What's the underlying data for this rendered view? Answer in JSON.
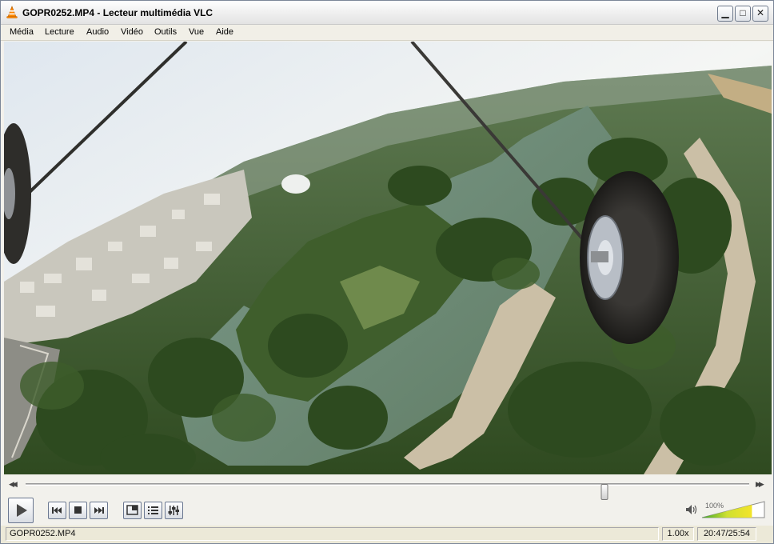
{
  "window": {
    "title": "GOPR0252.MP4 - Lecteur multimédia VLC",
    "app_icon": "vlc-cone-icon",
    "controls": [
      "minimize-icon",
      "maximize-icon",
      "close-icon"
    ]
  },
  "menu": {
    "items": [
      "Média",
      "Lecture",
      "Audio",
      "Vidéo",
      "Outils",
      "Vue",
      "Aide"
    ]
  },
  "video": {
    "description_icon": "video-frame"
  },
  "seek": {
    "position_fraction": 0.8,
    "back_icon": "seek-back-icon",
    "forward_icon": "seek-forward-icon"
  },
  "controls": {
    "play_icon": "play-icon",
    "prev_icon": "previous-icon",
    "stop_icon": "stop-icon",
    "next_icon": "next-icon",
    "fullscreen_icon": "fullscreen-icon",
    "playlist_icon": "playlist-icon",
    "extended_icon": "extended-settings-icon"
  },
  "volume": {
    "label": "100%",
    "level_percent": 100,
    "icon": "speaker-icon"
  },
  "status": {
    "filename": "GOPR0252.MP4",
    "rate": "1.00x",
    "time": "20:47/25:54"
  },
  "colors": {
    "accent_orange": "#ff8800",
    "volume_green": "#3fa82a",
    "volume_yellow": "#f3e42a"
  }
}
